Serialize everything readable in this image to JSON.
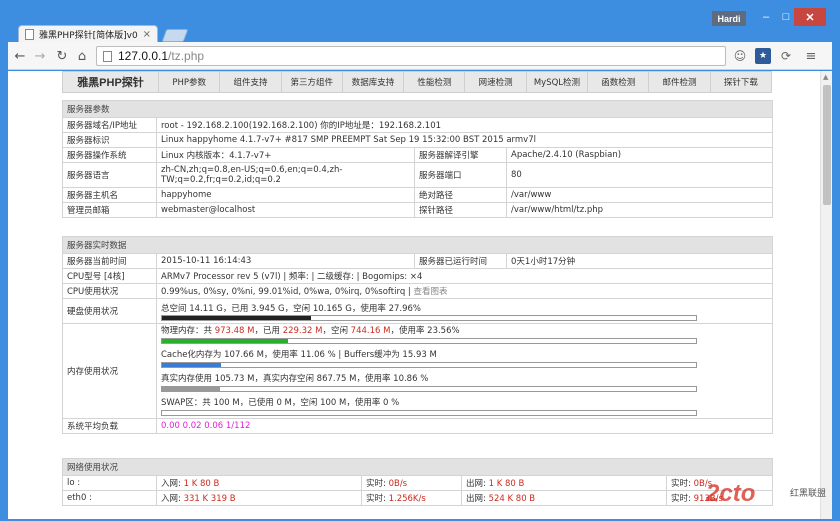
{
  "browser": {
    "tab_title": "雅黑PHP探针[简体版]v0.4",
    "tab_close": "×",
    "user": "Hardi",
    "min": "–",
    "max": "□",
    "close": "✕",
    "url_host": "127.0.0.1",
    "url_path": "/tz.php",
    "nav_back": "←",
    "nav_forward": "→",
    "nav_reload": "↻",
    "nav_home": "⌂",
    "menu": "≡",
    "ext1": "☺",
    "ext2": "★",
    "ext3": "⟳"
  },
  "topnav": {
    "brand": "雅黑PHP探针",
    "items": [
      "PHP参数",
      "组件支持",
      "第三方组件",
      "数据库支持",
      "性能检测",
      "网速检测",
      "MySQL检测",
      "函数检测",
      "邮件检测",
      "探针下载"
    ]
  },
  "server_params": {
    "section": "服务器参数",
    "domain_label": "服务器域名/IP地址",
    "domain_value": "root - 192.168.2.100(192.168.2.100)  你的IP地址是：192.168.2.101",
    "id_label": "服务器标识",
    "id_value": "Linux happyhome 4.1.7-v7+ #817 SMP PREEMPT Sat Sep 19 15:32:00 BST 2015 armv7l",
    "os_label": "服务器操作系统",
    "os_value": "Linux  内核版本：4.1.7-v7+",
    "engine_label": "服务器解译引擎",
    "engine_value": "Apache/2.4.10 (Raspbian)",
    "lang_label": "服务器语言",
    "lang_value": "zh-CN,zh;q=0.8,en-US;q=0.6,en;q=0.4,zh-TW;q=0.2,fr;q=0.2,id;q=0.2",
    "port_label": "服务器端口",
    "port_value": "80",
    "host_label": "服务器主机名",
    "host_value": "happyhome",
    "abspath_label": "绝对路径",
    "abspath_value": "/var/www",
    "admin_label": "管理员邮箱",
    "admin_value": "webmaster@localhost",
    "probe_label": "探针路径",
    "probe_value": "/var/www/html/tz.php"
  },
  "realtime": {
    "section": "服务器实时数据",
    "time_label": "服务器当前时间",
    "time_value": "2015-10-11 16:14:43",
    "uptime_label": "服务器已运行时间",
    "uptime_value": "0天1小时17分钟",
    "cpu_model_label": "CPU型号 [4核]",
    "cpu_model_value": "ARMv7 Processor rev 5 (v7l) | 频率: | 二级缓存: | Bogomips: ×4",
    "cpu_usage_label": "CPU使用状况",
    "cpu_usage_value": "0.99%us, 0%sy, 0%ni, 99.01%id, 0%wa, 0%irq, 0%softirq",
    "cpu_chart_link": "查看图表",
    "disk_label": "硬盘使用状况",
    "disk_text": "总空间 14.11 G，已用 3.945 G，空闲 10.165 G，使用率 27.96%",
    "disk_ratio": 0.2796,
    "mem_label": "内存使用状况",
    "mem_phys_prefix": "物理内存：共 ",
    "mem_phys_total": "973.48 M",
    "mem_phys_used_prefix": "，已用 ",
    "mem_phys_used": "229.32 M",
    "mem_phys_free_prefix": "，空闲 ",
    "mem_phys_free": "744.16 M",
    "mem_phys_ratio_text": "，使用率 23.56%",
    "mem_phys_ratio": 0.2356,
    "mem_cache_text": "Cache化内存为 107.66 M，使用率 11.06 % | Buffers缓冲为 15.93 M",
    "mem_cache_ratio": 0.1106,
    "mem_real_text": "真实内存使用 105.73 M，真实内存空闲 867.75 M，使用率 10.86 %",
    "mem_real_ratio": 0.1086,
    "swap_text": "SWAP区：共 100 M，已使用 0 M，空闲 100 M，使用率 0 %",
    "swap_ratio": 0,
    "load_label": "系统平均负载",
    "load_value": "0.00 0.02 0.06 1/112"
  },
  "network": {
    "section": "网络使用状况",
    "rows": [
      {
        "iface": "lo :",
        "in_label": "入网: ",
        "in": "1 K 80 B",
        "rt_in_label": "实时: ",
        "rt_in": "0B/s",
        "out_label": "出网: ",
        "out": "1 K 80 B",
        "rt_out_label": "实时: ",
        "rt_out": "0B/s"
      },
      {
        "iface": "eth0 :",
        "in_label": "入网: ",
        "in": "331 K 319 B",
        "rt_in_label": "实时: ",
        "rt_in": "1.256K/s",
        "out_label": "出网: ",
        "out": "524 K 80 B",
        "rt_out_label": "实时: ",
        "rt_out": "913B/s"
      }
    ]
  },
  "watermark": {
    "logo": "2cto",
    "text": "红黑联盟"
  }
}
